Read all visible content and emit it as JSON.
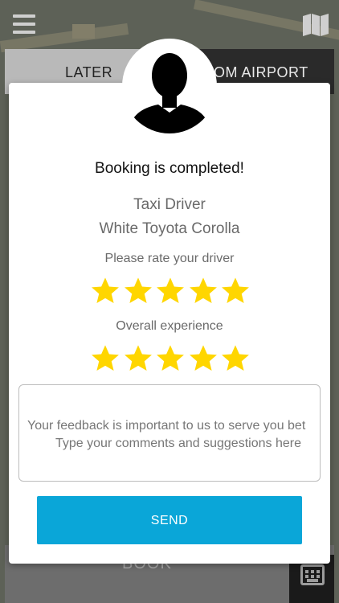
{
  "background": {
    "tabs": {
      "later": "LATER",
      "airport": "OM AIRPORT"
    },
    "book_label": "BOOK"
  },
  "modal": {
    "title": "Booking is completed!",
    "driver_name": "Taxi Driver",
    "vehicle": "White Toyota Corolla",
    "rate_driver_label": "Please rate your driver",
    "driver_rating": 5,
    "overall_label": "Overall experience",
    "overall_rating": 5,
    "feedback_line1": "Your feedback is important to us to serve you bet",
    "feedback_placeholder": "Type your comments and suggestions here",
    "send_label": "SEND"
  },
  "colors": {
    "accent": "#0aa6d8",
    "star": "#ffd600"
  },
  "icons": [
    "menu-icon",
    "map-icon",
    "driver-avatar-icon",
    "star-icon",
    "keypad-icon"
  ]
}
